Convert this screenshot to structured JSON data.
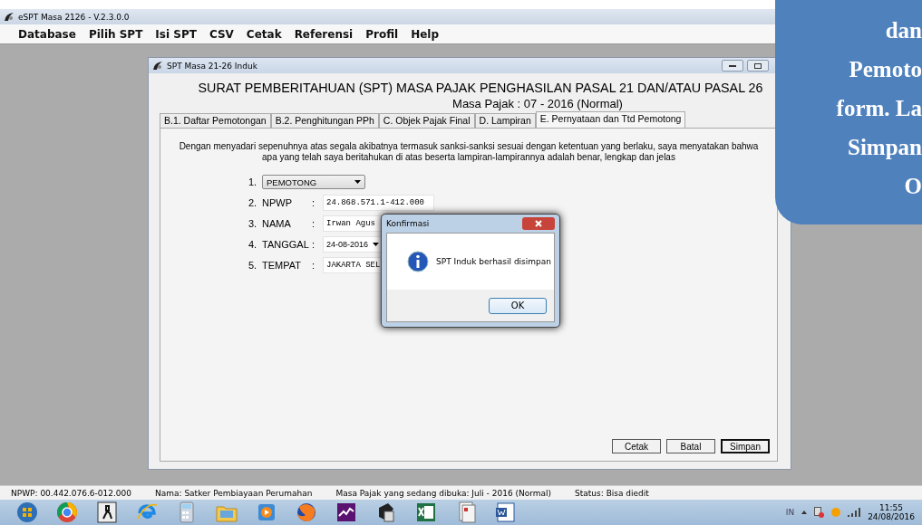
{
  "app": {
    "title": "eSPT Masa 2126 - V.2.3.0.0"
  },
  "menu": [
    "Database",
    "Pilih SPT",
    "Isi SPT",
    "CSV",
    "Cetak",
    "Referensi",
    "Profil",
    "Help"
  ],
  "child_window": {
    "title": "SPT Masa 21-26 Induk",
    "heading": "SURAT PEMBERITAHUAN (SPT) MASA PAJAK PENGHASILAN PASAL 21 DAN/ATAU PASAL 26",
    "period": "Masa Pajak :   07 - 2016 (Normal)"
  },
  "tabs": [
    {
      "label": "B.1. Daftar Pemotongan",
      "selected": false
    },
    {
      "label": "B.2. Penghitungan PPh",
      "selected": false
    },
    {
      "label": "C. Objek Pajak Final",
      "selected": false
    },
    {
      "label": "D. Lampiran",
      "selected": false
    },
    {
      "label": "E. Pernyataan dan Ttd Pemotong",
      "selected": true
    }
  ],
  "statement": "Dengan menyadari sepenuhnya atas segala akibatnya termasuk sanksi-sanksi sesuai dengan ketentuan yang berlaku, saya menyatakan bahwa apa yang telah saya beritahukan di atas beserta lampiran-lampirannya adalah benar, lengkap dan jelas",
  "form": [
    {
      "kind": "select",
      "number": "1.",
      "value": "PEMOTONG"
    },
    {
      "kind": "text",
      "number": "2.",
      "label": "NPWP",
      "value": "24.868.571.1-412.000"
    },
    {
      "kind": "text",
      "number": "3.",
      "label": "NAMA",
      "value": "Irwan Agus"
    },
    {
      "kind": "date",
      "number": "4.",
      "label": "TANGGAL",
      "value": "24-08-2016"
    },
    {
      "kind": "text",
      "number": "5.",
      "label": "TEMPAT",
      "value": "JAKARTA SEL"
    }
  ],
  "colon": ":",
  "buttons": [
    {
      "label": "Cetak",
      "default": false
    },
    {
      "label": "Batal",
      "default": false
    },
    {
      "label": "Simpan",
      "default": true
    }
  ],
  "dialog": {
    "title": "Konfirmasi",
    "message": "SPT Induk berhasil disimpan",
    "button": "OK"
  },
  "status_bar": [
    "NPWP: 00.442.076.6-012.000",
    "Nama: Satker Pembiayaan Perumahan",
    "Masa Pajak yang sedang dibuka: Juli - 2016 (Normal)",
    "Status: Bisa diedit"
  ],
  "taskbar": {
    "language": "IN",
    "time": "11:55",
    "date": "24/08/2016"
  },
  "callout": [
    "dan",
    "Pemoto",
    "form. La",
    "Simpan",
    "O"
  ]
}
